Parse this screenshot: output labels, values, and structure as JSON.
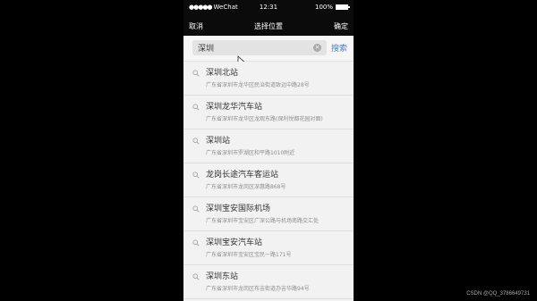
{
  "status_bar": {
    "signal": "●●●●●",
    "carrier": "WeChat",
    "time": "12:31",
    "battery": "100%"
  },
  "nav": {
    "cancel_label": "取消",
    "title": "选择位置",
    "confirm_label": "确定"
  },
  "search": {
    "value": "深圳",
    "search_label": "搜索",
    "clear_icon": "×"
  },
  "results": [
    {
      "name": "深圳北站",
      "address": "广东省深圳市龙华区民治街道致远中路28号"
    },
    {
      "name": "深圳龙华汽车站",
      "address": "广东省深圳市龙华区龙观东路(保利悦都花园对面)"
    },
    {
      "name": "深圳站",
      "address": "广东省深圳市罗湖区和平路1010附近"
    },
    {
      "name": "龙岗长途汽车客运站",
      "address": "广东省深圳市龙岗区深惠路868号"
    },
    {
      "name": "深圳宝安国际机场",
      "address": "广东省深圳市宝安区广深公路与机场南路交汇处"
    },
    {
      "name": "深圳宝安汽车站",
      "address": "广东省深圳市宝安区宝民一路171号"
    },
    {
      "name": "深圳东站",
      "address": "广东省深圳市龙岗区布吉街道办吉华路94号"
    }
  ],
  "watermark": "CSDN @QQ_3786649731"
}
